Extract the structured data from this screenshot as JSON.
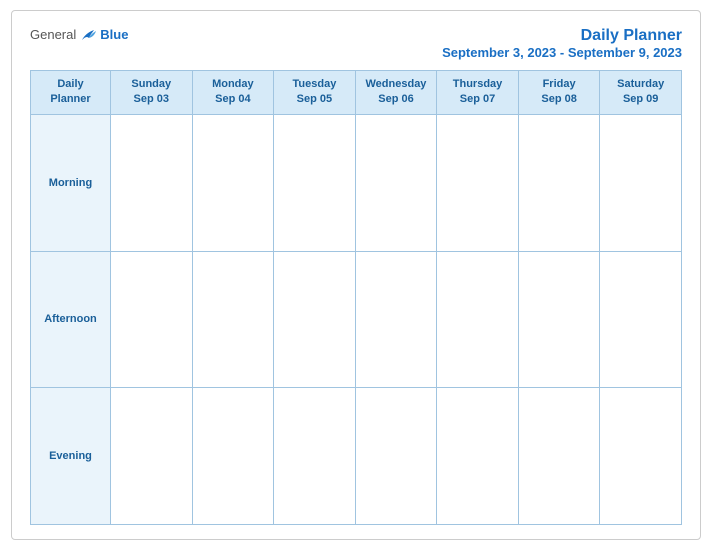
{
  "header": {
    "logo_general": "General",
    "logo_blue": "Blue",
    "title_main": "Daily Planner",
    "title_sub": "September 3, 2023 - September 9, 2023"
  },
  "table": {
    "header_label": "Daily\nPlanner",
    "columns": [
      {
        "day": "Sunday",
        "date": "Sep 03"
      },
      {
        "day": "Monday",
        "date": "Sep 04"
      },
      {
        "day": "Tuesday",
        "date": "Sep 05"
      },
      {
        "day": "Wednesday",
        "date": "Sep 06"
      },
      {
        "day": "Thursday",
        "date": "Sep 07"
      },
      {
        "day": "Friday",
        "date": "Sep 08"
      },
      {
        "day": "Saturday",
        "date": "Sep 09"
      }
    ],
    "rows": [
      {
        "label": "Morning"
      },
      {
        "label": "Afternoon"
      },
      {
        "label": "Evening"
      }
    ]
  }
}
